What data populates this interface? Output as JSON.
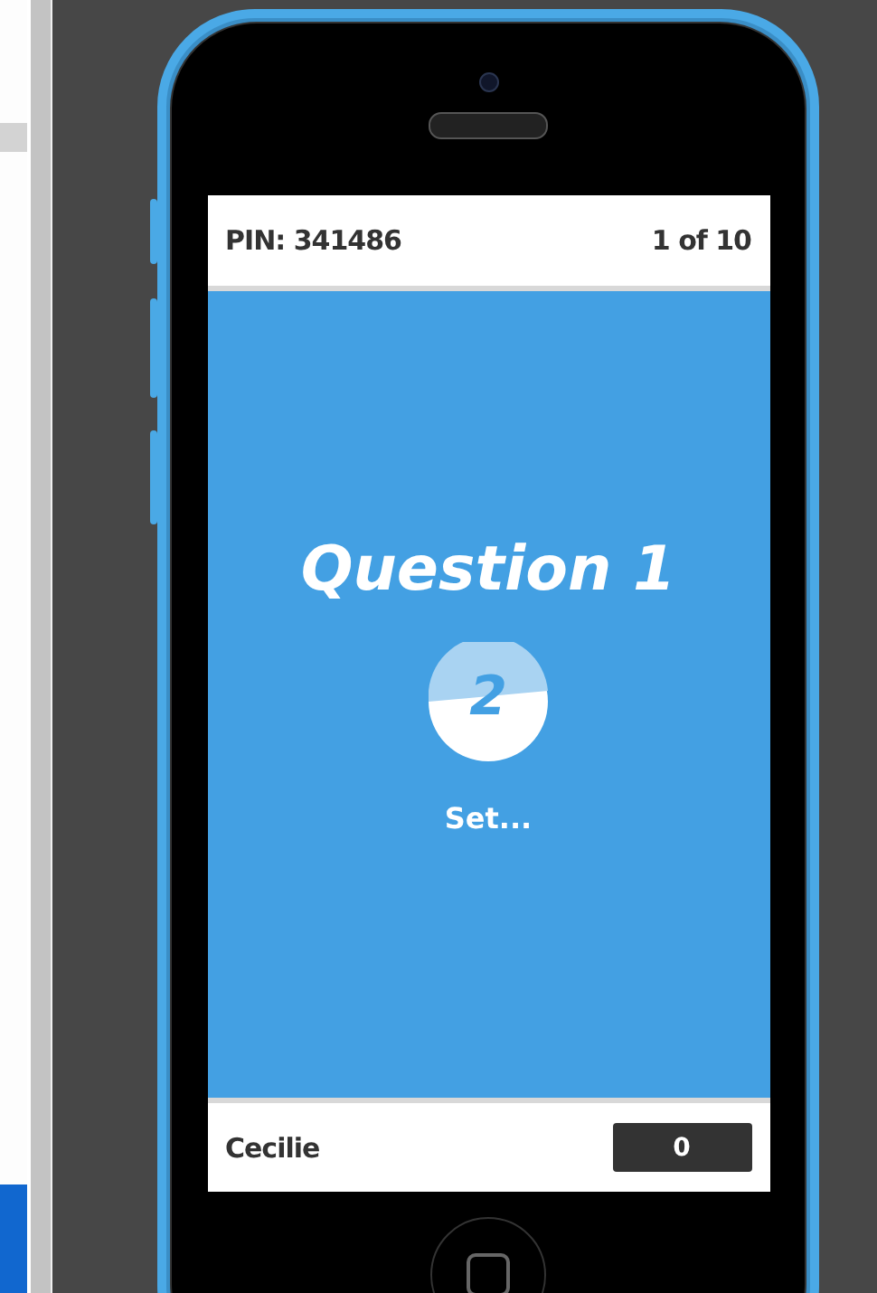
{
  "header": {
    "pin": "PIN: 341486",
    "progress": "1 of 10"
  },
  "question": {
    "title": "Question 1",
    "countdown": "2",
    "status": "Set..."
  },
  "footer": {
    "player": "Cecilie",
    "score": "0"
  }
}
